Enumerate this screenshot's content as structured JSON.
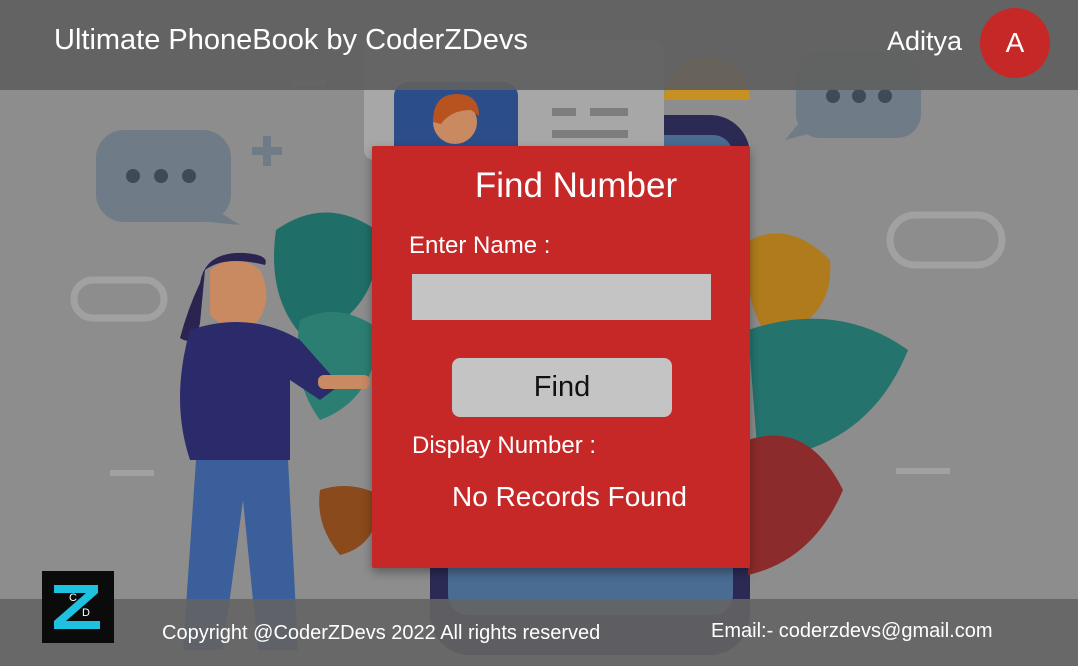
{
  "header": {
    "title": "Ultimate PhoneBook by CoderZDevs",
    "user_name": "Aditya",
    "avatar_letter": "A"
  },
  "card": {
    "title": "Find Number",
    "name_label": "Enter Name :",
    "name_input": {
      "value": "",
      "placeholder": ""
    },
    "find_button_label": "Find",
    "display_label": "Display Number :",
    "result": "No Records Found"
  },
  "footer": {
    "copyright": "Copyright @CoderZDevs 2022 All rights reserved",
    "email": "Email:- coderzdevs@gmail.com"
  },
  "logo": {
    "letters": [
      "C",
      "Z",
      "D"
    ]
  },
  "colors": {
    "accent_red": "#c62828",
    "header_bg": "#5f5f5f",
    "input_bg": "#c4c4c4",
    "logo_cyan": "#1ec1e0"
  }
}
